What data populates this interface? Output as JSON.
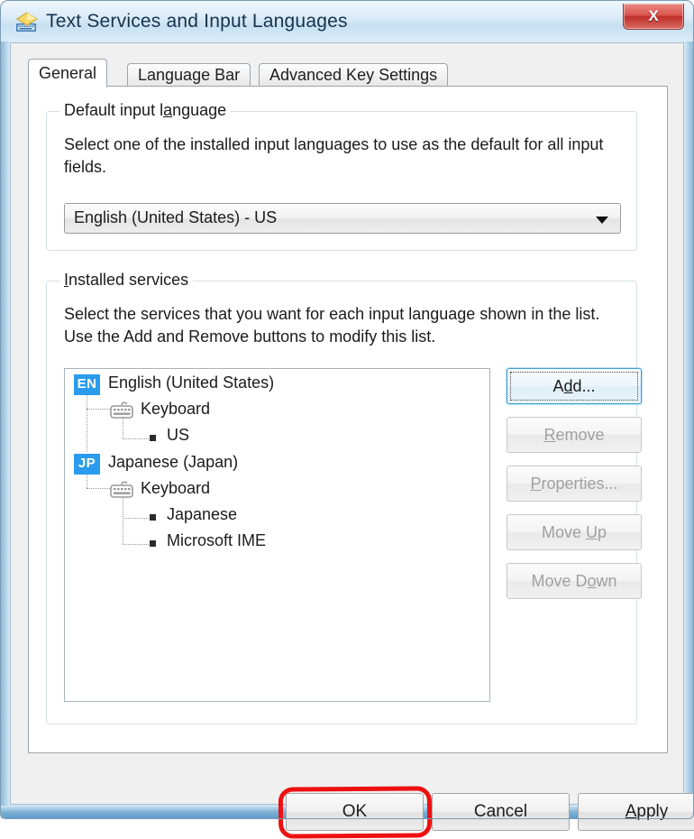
{
  "window": {
    "title": "Text Services and Input Languages",
    "icon": "text-services-icon",
    "close_label": "X",
    "accent_blue": "#2b9bee",
    "annotation_color": "#ee1111"
  },
  "tabs": [
    {
      "label": "General",
      "active": true
    },
    {
      "label": "Language Bar",
      "active": false
    },
    {
      "label": "Advanced Key Settings",
      "active": false
    }
  ],
  "default_input_language": {
    "group_title_pre": "Default input l",
    "group_title_acc": "a",
    "group_title_post": "nguage",
    "description": "Select one of the installed input languages to use as the default for all input fields.",
    "selected": "English (United States) - US"
  },
  "installed_services": {
    "group_title_acc": "I",
    "group_title_post": "nstalled services",
    "description": "Select the services that you want for each input language shown in the list. Use the Add and Remove buttons to modify this list.",
    "tree": [
      {
        "type": "language",
        "badge": "EN",
        "label": "English (United States)"
      },
      {
        "type": "category",
        "icon": "keyboard-icon",
        "label": "Keyboard"
      },
      {
        "type": "leaf",
        "label": "US"
      },
      {
        "type": "language",
        "badge": "JP",
        "label": "Japanese (Japan)"
      },
      {
        "type": "category",
        "icon": "keyboard-icon",
        "label": "Keyboard"
      },
      {
        "type": "leaf",
        "label": "Japanese"
      },
      {
        "type": "leaf",
        "label": "Microsoft IME"
      }
    ],
    "buttons": [
      {
        "name": "add",
        "pre": "A",
        "acc": "d",
        "post": "d...",
        "enabled": true,
        "focused": true
      },
      {
        "name": "remove",
        "pre": "",
        "acc": "R",
        "post": "emove",
        "enabled": false,
        "focused": false
      },
      {
        "name": "properties",
        "pre": "",
        "acc": "P",
        "post": "roperties...",
        "enabled": false,
        "focused": false
      },
      {
        "name": "move-up",
        "pre": "Move ",
        "acc": "U",
        "post": "p",
        "enabled": false,
        "focused": false
      },
      {
        "name": "move-down",
        "pre": "Move D",
        "acc": "o",
        "post": "wn",
        "enabled": false,
        "focused": false
      }
    ]
  },
  "dialog_buttons": {
    "ok": {
      "pre": "OK",
      "acc": "",
      "post": ""
    },
    "cancel": {
      "pre": "Cancel",
      "acc": "",
      "post": ""
    },
    "apply": {
      "pre": "",
      "acc": "A",
      "post": "pply"
    }
  }
}
